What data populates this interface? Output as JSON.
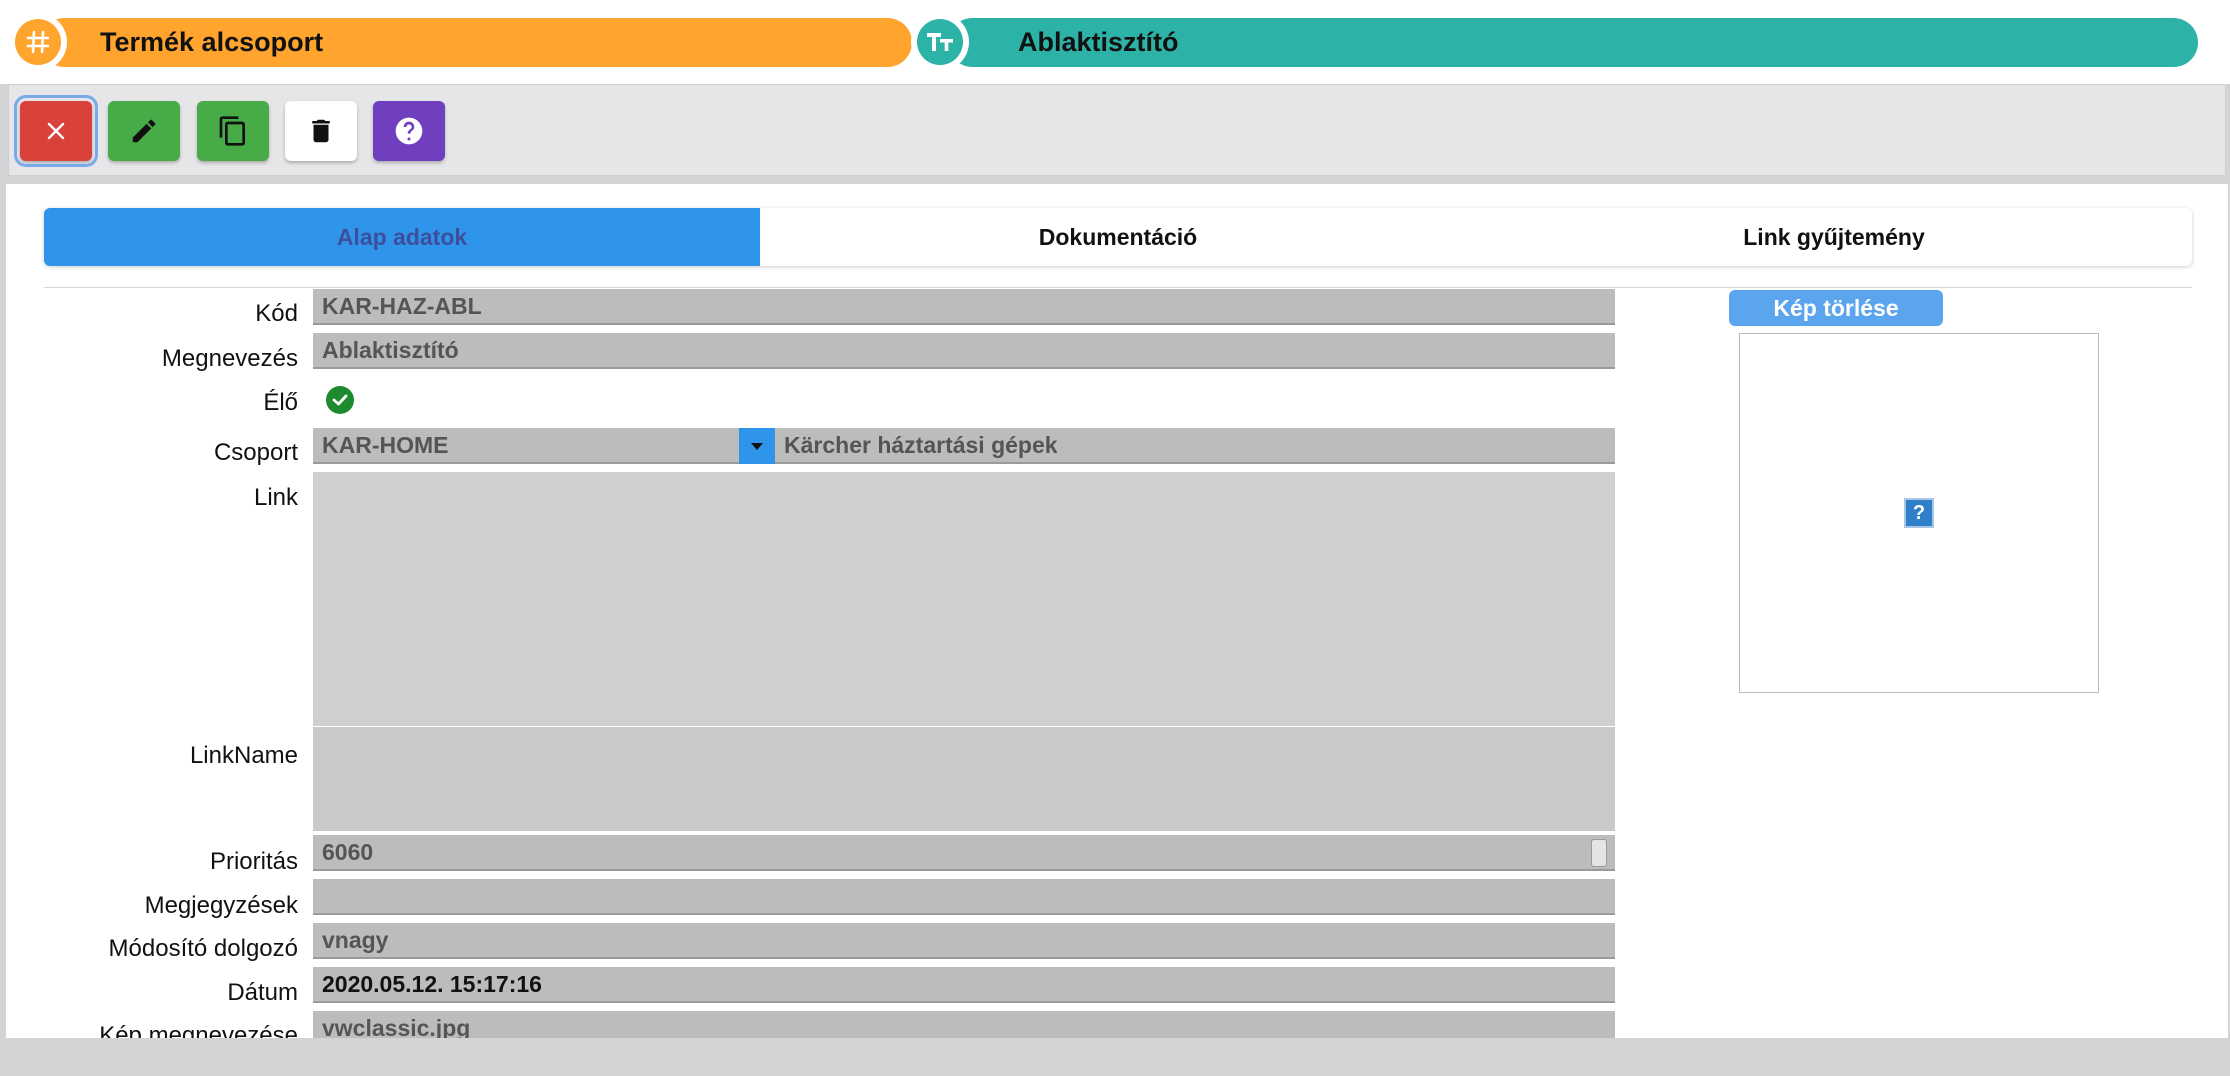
{
  "header": {
    "group_label": "Termék alcsoport",
    "group_icon": "hash-icon",
    "name_label": "Ablaktisztító",
    "name_icon": "text-type-icon"
  },
  "toolbar": {
    "buttons": [
      {
        "name": "close",
        "icon": "close-icon",
        "color": "#d9423b"
      },
      {
        "name": "edit",
        "icon": "pencil-icon",
        "color": "#47ab48"
      },
      {
        "name": "copy",
        "icon": "copy-icon",
        "color": "#47ab48"
      },
      {
        "name": "delete",
        "icon": "trash-icon",
        "color": "#ffffff"
      },
      {
        "name": "help",
        "icon": "question-icon",
        "color": "#6f3fbf"
      }
    ]
  },
  "tabs": [
    {
      "label": "Alap adatok",
      "active": true
    },
    {
      "label": "Dokumentáció",
      "active": false
    },
    {
      "label": "Link gyűjtemény",
      "active": false
    }
  ],
  "form": {
    "kod": {
      "label": "Kód",
      "value": "KAR-HAZ-ABL"
    },
    "megnevezes": {
      "label": "Megnevezés",
      "value": "Ablaktisztító"
    },
    "elo": {
      "label": "Élő",
      "checked": true
    },
    "csoport": {
      "label": "Csoport",
      "code": "KAR-HOME",
      "name": "Kärcher háztartási gépek"
    },
    "link": {
      "label": "Link",
      "value": ""
    },
    "linkname": {
      "label": "LinkName",
      "value": ""
    },
    "prioritas": {
      "label": "Prioritás",
      "value": "6060"
    },
    "megjegyzesek": {
      "label": "Megjegyzések",
      "value": ""
    },
    "modosito": {
      "label": "Módosító dolgozó",
      "value": "vnagy"
    },
    "datum": {
      "label": "Dátum",
      "value": "2020.05.12. 15:17:16"
    },
    "kep": {
      "label": "Kép megnevezése",
      "value": "vwclassic.jpg"
    }
  },
  "image": {
    "delete_label": "Kép törlése",
    "placeholder": "?"
  },
  "colors": {
    "accent_orange": "#ffa42d",
    "accent_teal": "#2cb2a6",
    "tab_active": "#2f95ea"
  }
}
